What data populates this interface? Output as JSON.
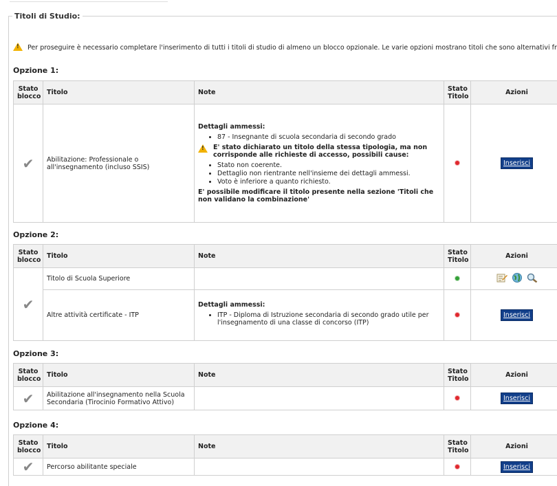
{
  "section_title": "Titoli di Studio:",
  "warning_text": "Per proseguire è necessario completare l'inserimento di tutti i titoli di studio di almeno un blocco opzionale. Le varie opzioni mostrano titoli che sono alternativi fra loro:",
  "table_headers": {
    "stato_blocco": "Stato blocco",
    "titolo": "Titolo",
    "note": "Note",
    "stato_titolo": "Stato Titolo",
    "azioni": "Azioni"
  },
  "insert_label": "Inserisci",
  "options": [
    {
      "label": "Opzione 1:",
      "rows": [
        {
          "titolo": "Abilitazione: Professionale o all'insegnamento (incluso SSIS)",
          "note_title": "Dettagli ammessi:",
          "note_items": [
            "87 - Insegnante di scuola secondaria di secondo grado"
          ],
          "warning": "E' stato dichiarato un titolo della stessa tipologia, ma non corrisponde alle richieste di accesso, possibili cause:",
          "causes": [
            "Stato non coerente.",
            "Dettaglio non rientrante nell'insieme dei dettagli ammessi.",
            "Voto è inferiore a quanto richiesto."
          ],
          "footer": "E' possibile modificare il titolo presente nella sezione 'Titoli che non validano la combinazione'",
          "status": "red"
        }
      ]
    },
    {
      "label": "Opzione 2:",
      "rows": [
        {
          "titolo": "Titolo di Scuola Superiore",
          "status": "green"
        },
        {
          "titolo": "Altre attività certificate - ITP",
          "note_title": "Dettagli ammessi:",
          "note_items": [
            "ITP - Diploma di Istruzione secondaria di secondo grado utile per l'insegnamento di una classe di concorso (ITP)"
          ],
          "status": "red"
        }
      ]
    },
    {
      "label": "Opzione 3:",
      "rows": [
        {
          "titolo": "Abilitazione all'insegnamento nella Scuola Secondaria (Tirocinio Formativo Attivo)",
          "status": "red"
        }
      ]
    },
    {
      "label": "Opzione 4:",
      "rows": [
        {
          "titolo": "Percorso abilitante speciale",
          "status": "red"
        }
      ]
    }
  ],
  "colors": {
    "red": "#e0282e",
    "green": "#34a037",
    "button": "#123f8a",
    "warning": "#f2b200"
  }
}
